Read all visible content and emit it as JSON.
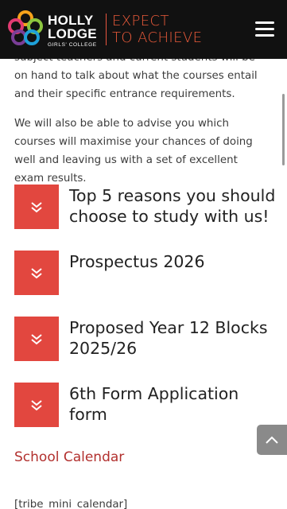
{
  "header": {
    "logo_line1": "HOLLY",
    "logo_line2": "LODGE",
    "logo_line3": "GIRLS' COLLEGE",
    "tagline_line1": "EXPECT",
    "tagline_line2": "TO ACHIEVE",
    "menu_icon": "hamburger-menu-icon"
  },
  "content": {
    "para1": "subject teachers and current students will be on hand to talk about what the courses entail and their specific entrance requirements.",
    "para2": "We will also be able to advise you which courses will maximise your chances of doing well and leaving us with a set of excellent exam results.",
    "accordion": [
      {
        "title": "Top 5 reasons you should choose to study with us!",
        "icon": "double-chevron-down-icon"
      },
      {
        "title": "Prospectus 2026",
        "icon": "double-chevron-down-icon"
      },
      {
        "title": "Proposed Year 12 Blocks 2025/26",
        "icon": "double-chevron-down-icon"
      },
      {
        "title": "6th Form Application form",
        "icon": "double-chevron-down-icon"
      }
    ],
    "calendar_link": "School Calendar",
    "shortcode": "[tribe_mini_calendar]"
  },
  "colors": {
    "header_bg": "#111111",
    "accent_red": "#e2473f",
    "tagline_orange": "#ea5a3a",
    "link_red": "#b2302e"
  },
  "back_to_top_icon": "chevron-up-icon"
}
